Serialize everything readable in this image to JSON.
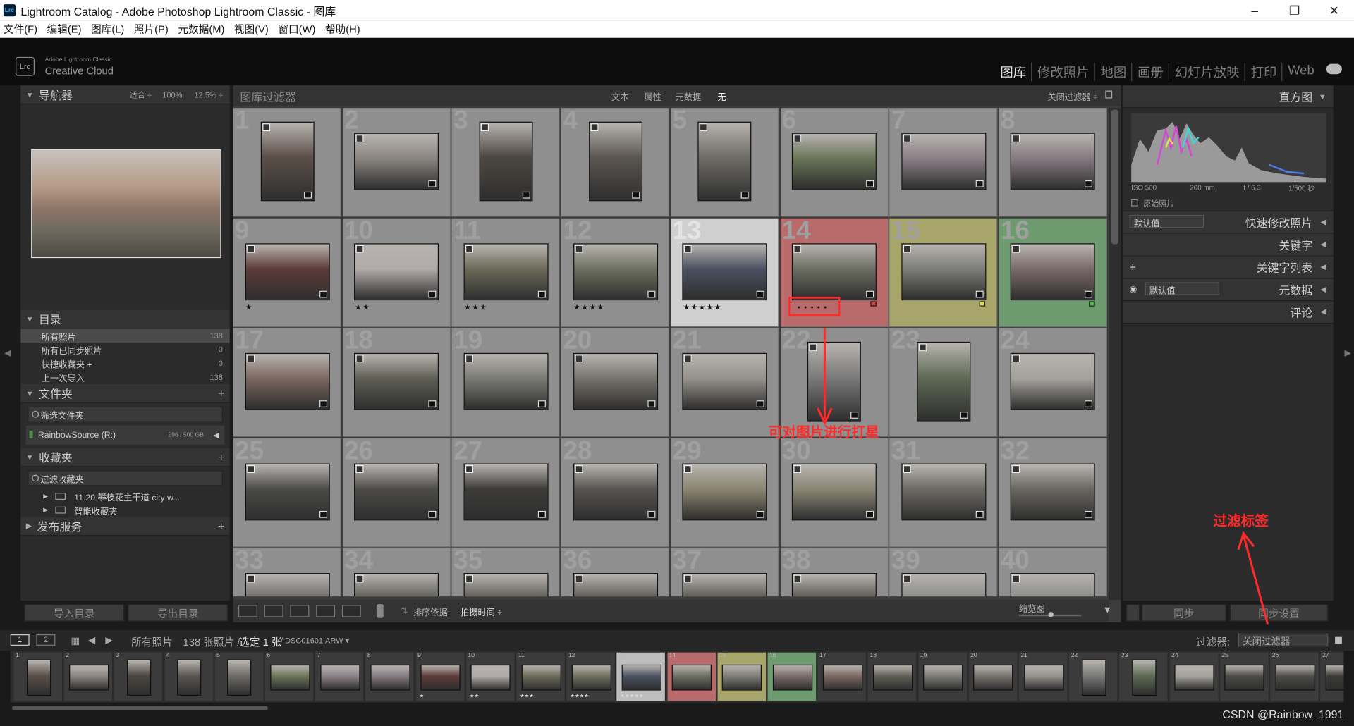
{
  "window": {
    "title": "Lightroom Catalog - Adobe Photoshop Lightroom Classic - 图库",
    "app_icon": "Lrc",
    "minimize_icon": "–",
    "restore_icon": "❐",
    "close_icon": "✕"
  },
  "menu": [
    "文件(F)",
    "编辑(E)",
    "图库(L)",
    "照片(P)",
    "元数据(M)",
    "视图(V)",
    "窗口(W)",
    "帮助(H)"
  ],
  "identity": {
    "logo": "Lrc",
    "line1": "Adobe Lightroom Classic",
    "line2": "Creative Cloud"
  },
  "modules": [
    "图库",
    "修改照片",
    "地图",
    "画册",
    "幻灯片放映",
    "打印",
    "Web"
  ],
  "navigator": {
    "title": "导航器",
    "zoom": [
      "适合 ÷",
      "100%",
      "12.5% ÷"
    ]
  },
  "catalog": {
    "title": "目录",
    "items": [
      {
        "label": "所有照片",
        "count": "138"
      },
      {
        "label": "所有已同步照片",
        "count": "0"
      },
      {
        "label": "快捷收藏夹 +",
        "count": "0"
      },
      {
        "label": "上一次导入",
        "count": "138"
      }
    ]
  },
  "folders": {
    "title": "文件夹",
    "search": "筛选文件夹",
    "volume": "RainbowSource (R:)",
    "volume_size": "296 / 500 GB"
  },
  "collections": {
    "title": "收藏夹",
    "search": "过滤收藏夹",
    "items": [
      "11.20 攀枝花主干道 city w...",
      "智能收藏夹"
    ]
  },
  "publish": {
    "title": "发布服务"
  },
  "left_buttons": {
    "import": "导入目录",
    "export": "导出目录"
  },
  "filter_bar": {
    "title": "图库过滤器",
    "tabs": [
      "文本",
      "属性",
      "元数据",
      "无"
    ],
    "right_label": "关闭过滤器 ÷"
  },
  "grid": {
    "cells": [
      {
        "n": "1",
        "stars": "",
        "label": "",
        "tone": "#5a4e48"
      },
      {
        "n": "2",
        "stars": "",
        "label": "",
        "tone": "#8a8580"
      },
      {
        "n": "3",
        "stars": "",
        "label": "",
        "tone": "#4b4640"
      },
      {
        "n": "4",
        "stars": "",
        "label": "",
        "tone": "#5b5651"
      },
      {
        "n": "5",
        "stars": "",
        "label": "",
        "tone": "#6e6c66"
      },
      {
        "n": "6",
        "stars": "",
        "label": "",
        "tone": "#6a7558"
      },
      {
        "n": "7",
        "stars": "",
        "label": "",
        "tone": "#8a7f86"
      },
      {
        "n": "8",
        "stars": "",
        "label": "",
        "tone": "#857a80"
      },
      {
        "n": "9",
        "stars": "★",
        "label": "",
        "tone": "#5b3b38"
      },
      {
        "n": "10",
        "stars": "★★",
        "label": "",
        "tone": "#b0aaa8"
      },
      {
        "n": "11",
        "stars": "★★★",
        "label": "",
        "tone": "#6b6a58"
      },
      {
        "n": "12",
        "stars": "★★★★",
        "label": "",
        "tone": "#6c705e"
      },
      {
        "n": "13",
        "stars": "★★★★★",
        "label": "selected",
        "tone": "#4a5060"
      },
      {
        "n": "14",
        "stars": "",
        "label": "red",
        "tone": "#6b6e62"
      },
      {
        "n": "15",
        "stars": "",
        "label": "yellow",
        "tone": "#7c7c78"
      },
      {
        "n": "16",
        "stars": "",
        "label": "green",
        "tone": "#7a6a6a"
      },
      {
        "n": "17",
        "stars": "",
        "label": "",
        "tone": "#7a6660"
      },
      {
        "n": "18",
        "stars": "",
        "label": "",
        "tone": "#5e5e55"
      },
      {
        "n": "19",
        "stars": "",
        "label": "",
        "tone": "#7a7a74"
      },
      {
        "n": "20",
        "stars": "",
        "label": "",
        "tone": "#76726c"
      },
      {
        "n": "21",
        "stars": "",
        "label": "",
        "tone": "#94908a"
      },
      {
        "n": "22",
        "stars": "",
        "label": "",
        "tone": "#7a7a7a"
      },
      {
        "n": "23",
        "stars": "",
        "label": "",
        "tone": "#5e6a54"
      },
      {
        "n": "24",
        "stars": "",
        "label": "",
        "tone": "#a4a29c"
      },
      {
        "n": "25",
        "stars": "",
        "label": "",
        "tone": "#4a4a48"
      },
      {
        "n": "26",
        "stars": "",
        "label": "",
        "tone": "#4c4b48"
      },
      {
        "n": "27",
        "stars": "",
        "label": "",
        "tone": "#3c3b38"
      },
      {
        "n": "28",
        "stars": "",
        "label": "",
        "tone": "#565450"
      },
      {
        "n": "29",
        "stars": "",
        "label": "",
        "tone": "#8a8470"
      },
      {
        "n": "30",
        "stars": "",
        "label": "",
        "tone": "#8a8674"
      },
      {
        "n": "31",
        "stars": "",
        "label": "",
        "tone": "#6c6a64"
      },
      {
        "n": "32",
        "stars": "",
        "label": "",
        "tone": "#6a6660"
      },
      {
        "n": "33",
        "stars": "",
        "label": "",
        "tone": "#6a6a68"
      },
      {
        "n": "34",
        "stars": "",
        "label": "",
        "tone": "#5a5a55"
      },
      {
        "n": "35",
        "stars": "",
        "label": "",
        "tone": "#5c5a55"
      },
      {
        "n": "36",
        "stars": "",
        "label": "",
        "tone": "#5c5753"
      },
      {
        "n": "37",
        "stars": "",
        "label": "",
        "tone": "#58564f"
      },
      {
        "n": "38",
        "stars": "",
        "label": "",
        "tone": "#595650"
      },
      {
        "n": "39",
        "stars": "",
        "label": "",
        "tone": "#8a8a88"
      },
      {
        "n": "40",
        "stars": "",
        "label": "",
        "tone": "#8a8a88"
      }
    ]
  },
  "toolbar": {
    "sort_by": "排序依据:",
    "sort_value": "拍摄时间 ÷",
    "thumb_label": "缩览图"
  },
  "right_panel": {
    "histogram": "直方图",
    "exif": [
      "ISO 500",
      "200 mm",
      "f / 6.3",
      "1/500 秒"
    ],
    "original": "原始照片",
    "quick_develop": "快速修改照片",
    "preset": "默认值",
    "keywords": "关键字",
    "keyword_list": "关键字列表",
    "metadata": "元数据",
    "metadata_preset": "默认值",
    "comments": "评论",
    "sync": "同步",
    "sync_settings": "同步设置"
  },
  "filmbar": {
    "pages": [
      "1",
      "2"
    ],
    "source": "所有照片",
    "count": "138 张照片 /",
    "selected": "选定 1 张",
    "file": "/ DSC01601.ARW ▾",
    "filter_label": "过滤器:",
    "filter_value": "关闭过滤器"
  },
  "filmstrip": {
    "count_shown": 27
  },
  "annotations": {
    "rating_note": "可对图片进行打星",
    "filter_note": "过滤标签"
  },
  "watermark": "CSDN @Rainbow_1991",
  "colors": {
    "red_label": "#b96a6a",
    "yellow_label": "#a8a56a",
    "green_label": "#6e9a70",
    "selected_cell": "#cfcfcf",
    "annotation": "#ff2a2a"
  }
}
